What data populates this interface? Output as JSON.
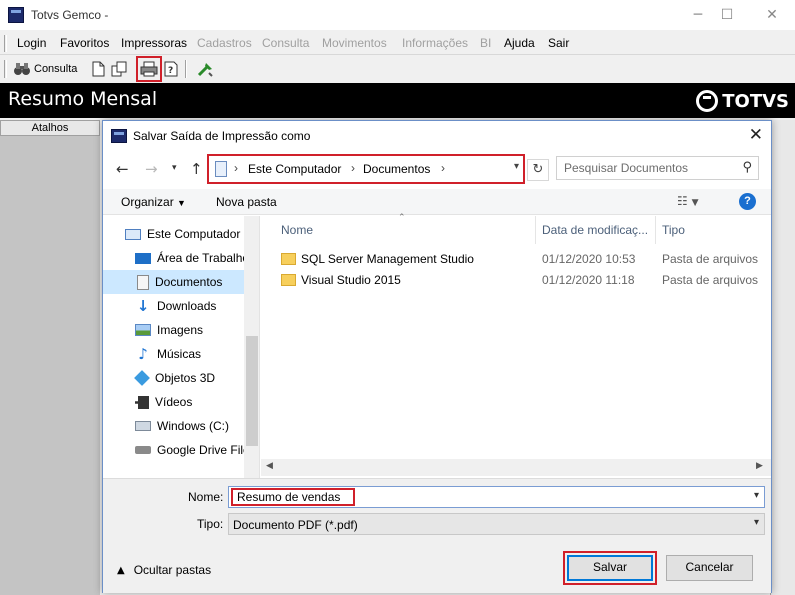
{
  "app": {
    "title": "Totvs Gemco -",
    "window_controls": [
      "minimize-icon",
      "maximize-icon",
      "close-icon"
    ]
  },
  "menu": [
    {
      "label": "Login",
      "enabled": true
    },
    {
      "label": "Favoritos",
      "enabled": true
    },
    {
      "label": "Impressoras",
      "enabled": true
    },
    {
      "label": "Cadastros",
      "enabled": false
    },
    {
      "label": "Consulta",
      "enabled": false
    },
    {
      "label": "Movimentos",
      "enabled": false
    },
    {
      "label": "Informações",
      "enabled": false
    },
    {
      "label": "BI",
      "enabled": false
    },
    {
      "label": "Ajuda",
      "enabled": true
    },
    {
      "label": "Sair",
      "enabled": true
    }
  ],
  "toolbar": {
    "consulta_label": "Consulta",
    "icons": [
      "binoculars-icon",
      "new-document-icon",
      "copy-document-icon",
      "printer-icon",
      "help-document-icon",
      "tools-icon"
    ]
  },
  "banner": {
    "title": "Resumo Mensal",
    "brand": "TOTVS"
  },
  "left_panel": {
    "header": "Atalhos"
  },
  "dialog": {
    "title": "Salvar Saída de Impressão como",
    "breadcrumb": [
      "Este Computador",
      "Documentos"
    ],
    "search_placeholder": "Pesquisar Documentos",
    "organize_label": "Organizar",
    "new_folder_label": "Nova pasta",
    "help_label": "?",
    "nav_items": [
      {
        "label": "Este Computador",
        "icon": "computer-icon"
      },
      {
        "label": "Área de Trabalho",
        "icon": "desktop-icon"
      },
      {
        "label": "Documentos",
        "icon": "documents-icon",
        "selected": true
      },
      {
        "label": "Downloads",
        "icon": "download-icon"
      },
      {
        "label": "Imagens",
        "icon": "pictures-icon"
      },
      {
        "label": "Músicas",
        "icon": "music-icon"
      },
      {
        "label": "Objetos 3D",
        "icon": "3d-objects-icon"
      },
      {
        "label": "Vídeos",
        "icon": "videos-icon"
      },
      {
        "label": "Windows (C:)",
        "icon": "drive-icon"
      },
      {
        "label": "Google Drive File",
        "icon": "google-drive-icon"
      }
    ],
    "columns": {
      "name": "Nome",
      "date": "Data de modificaç...",
      "type": "Tipo"
    },
    "files": [
      {
        "name": "SQL Server Management Studio",
        "date": "01/12/2020 10:53",
        "type": "Pasta de arquivos"
      },
      {
        "name": "Visual Studio 2015",
        "date": "01/12/2020 11:18",
        "type": "Pasta de arquivos"
      }
    ],
    "filename_label": "Nome:",
    "filename_value": "Resumo de vendas",
    "filetype_label": "Tipo:",
    "filetype_value": "Documento PDF (*.pdf)",
    "hide_folders_label": "Ocultar pastas",
    "save_label": "Salvar",
    "cancel_label": "Cancelar"
  },
  "colors": {
    "highlight_red": "#d0202a",
    "selection_blue": "#cce8ff",
    "banner_black": "#000000",
    "accent_blue": "#0078d7"
  }
}
